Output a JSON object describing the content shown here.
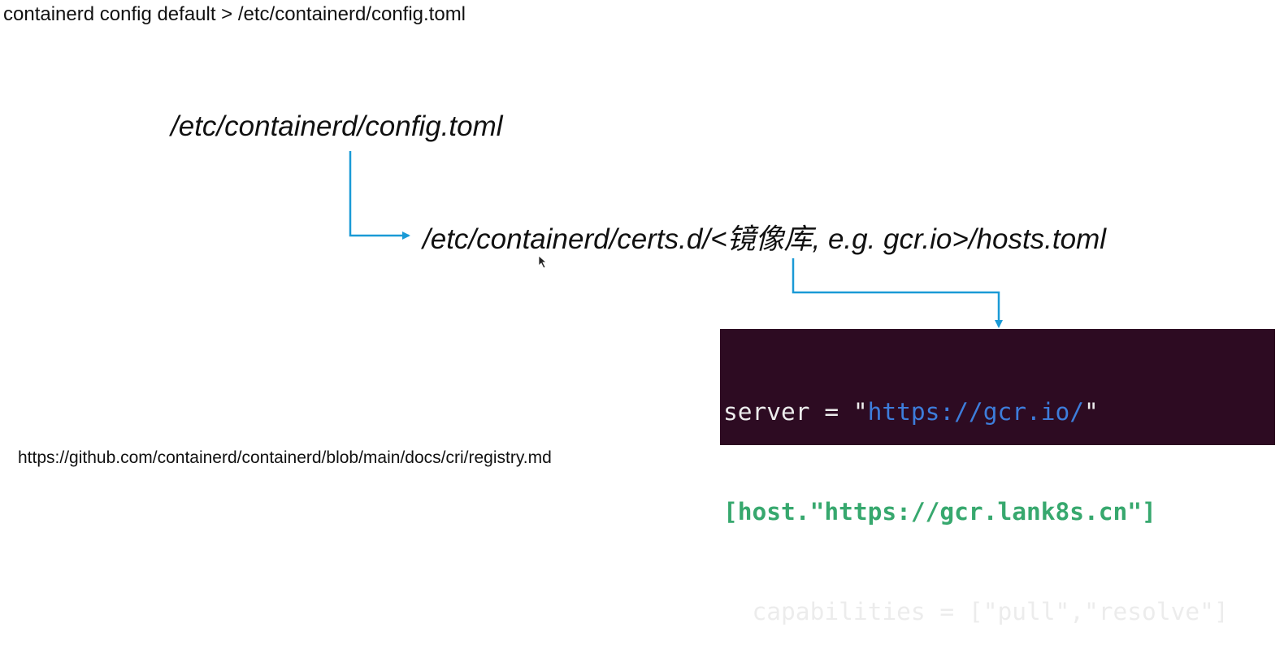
{
  "command": "containerd config default > /etc/containerd/config.toml",
  "config_path": "/etc/containerd/config.toml",
  "hosts_path": "/etc/containerd/certs.d/<镜像库, e.g. gcr.io>/hosts.toml",
  "terminal": {
    "line1": {
      "key": "server = \"",
      "url": "https://gcr.io/",
      "end": "\""
    },
    "line2": "[host.\"https://gcr.lank8s.cn\"]",
    "line3": "  capabilities = [\"pull\",\"resolve\"]"
  },
  "footer_link": "https://github.com/containerd/containerd/blob/main/docs/cri/registry.md",
  "colors": {
    "arrow": "#1a9ad6",
    "terminal_bg": "#2d0b22",
    "url": "#3d7ddb",
    "host": "#37a86e"
  }
}
